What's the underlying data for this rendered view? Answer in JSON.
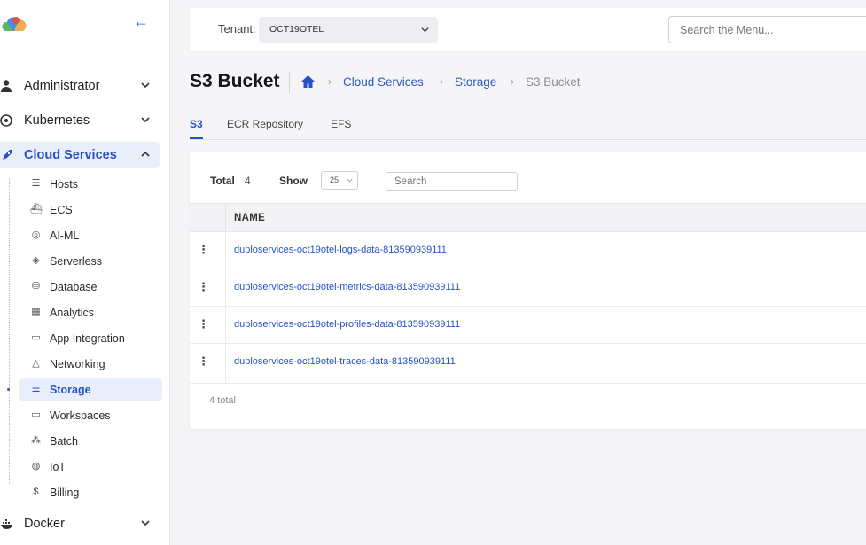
{
  "nav": {
    "groups_top": [
      {
        "label": "Administrator",
        "icon": "user-icon"
      },
      {
        "label": "Kubernetes",
        "icon": "helm-icon"
      }
    ],
    "cloud_services": {
      "label": "Cloud Services",
      "icon": "rocket-icon",
      "items": [
        {
          "label": "Hosts",
          "icon": "server-icon"
        },
        {
          "label": "ECS",
          "icon": "docker-icon"
        },
        {
          "label": "AI-ML",
          "icon": "ai-icon"
        },
        {
          "label": "Serverless",
          "icon": "layers-icon"
        },
        {
          "label": "Database",
          "icon": "database-icon"
        },
        {
          "label": "Analytics",
          "icon": "grid-icon"
        },
        {
          "label": "App Integration",
          "icon": "card-icon"
        },
        {
          "label": "Networking",
          "icon": "network-icon"
        },
        {
          "label": "Storage",
          "icon": "storage-icon"
        },
        {
          "label": "Workspaces",
          "icon": "monitor-icon"
        },
        {
          "label": "Batch",
          "icon": "batch-icon"
        },
        {
          "label": "IoT",
          "icon": "iot-icon"
        },
        {
          "label": "Billing",
          "icon": "dollar-icon"
        }
      ]
    },
    "docker": {
      "label": "Docker",
      "icon": "docker-icon"
    }
  },
  "topbar": {
    "tenant_label": "Tenant:",
    "tenant_value": "OCT19OTEL",
    "search_placeholder": "Search the Menu..."
  },
  "page": {
    "title": "S3 Bucket",
    "breadcrumb": [
      "Cloud Services",
      "Storage",
      "S3 Bucket"
    ]
  },
  "tabs": [
    "S3",
    "ECR Repository",
    "EFS"
  ],
  "table": {
    "total_label": "Total",
    "total_value": "4",
    "show_label": "Show",
    "show_value": "25",
    "search_placeholder": "Search",
    "column_name": "NAME",
    "rows": [
      "duploservices-oct19otel-logs-data-813590939111",
      "duploservices-oct19otel-metrics-data-813590939111",
      "duploservices-oct19otel-profiles-data-813590939111",
      "duploservices-oct19otel-traces-data-813590939111"
    ],
    "footer": "4 total"
  },
  "colors": {
    "accent": "#2652c8",
    "active_bg": "#e9eefb"
  }
}
